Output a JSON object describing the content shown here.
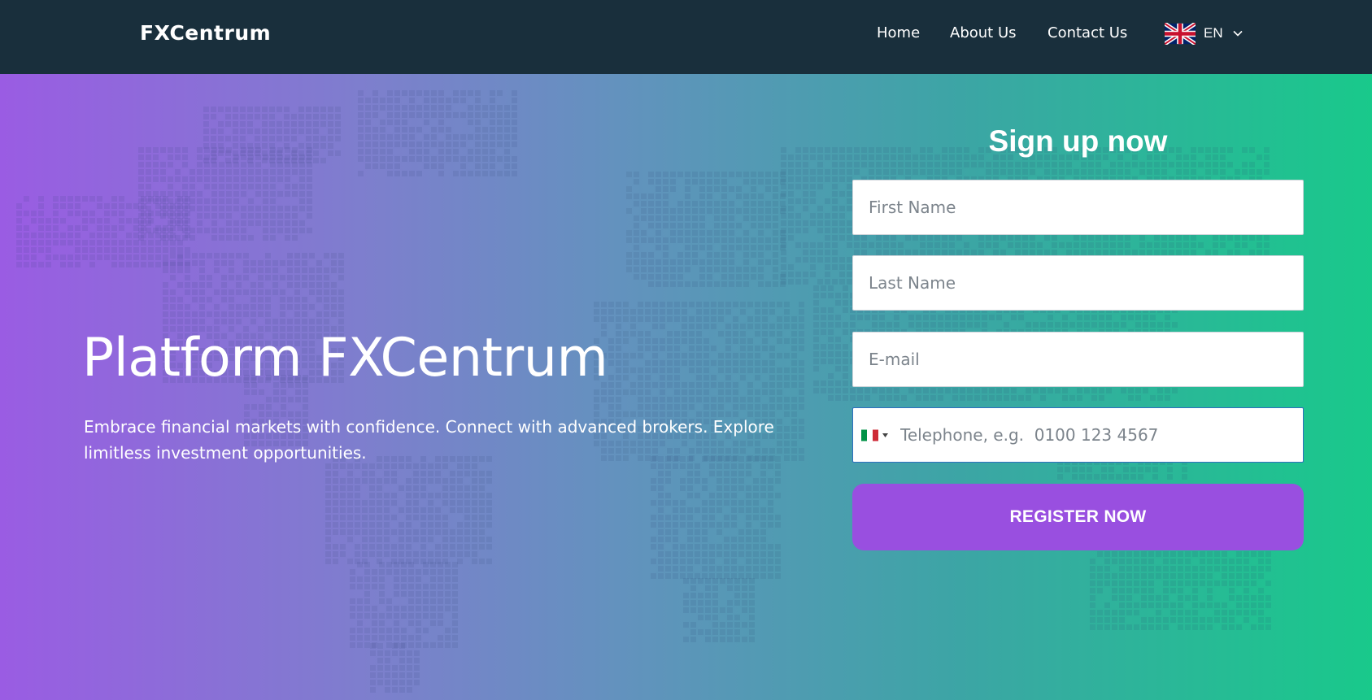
{
  "nav": {
    "logo": "FXCentrum",
    "links": {
      "home": "Home",
      "about": "About Us",
      "contact": "Contact Us"
    },
    "language": {
      "code": "EN",
      "flag_icon": "uk-flag-icon"
    }
  },
  "hero": {
    "title": "Platform FXCentrum",
    "subtitle": "Embrace financial markets with confidence. Connect with advanced brokers. Explore limitless investment opportunities."
  },
  "form": {
    "title": "Sign up now",
    "first_name_placeholder": "First Name",
    "last_name_placeholder": "Last Name",
    "email_placeholder": "E-mail",
    "phone_placeholder": "Telephone, e.g.  0100 123 4567",
    "phone_country_icon": "italy-flag-icon",
    "submit_label": "REGISTER NOW"
  },
  "colors": {
    "nav_bg": "#192f3c",
    "gradient_start": "#9a5ce3",
    "gradient_end": "#19c98b",
    "button": "#994fe0"
  }
}
